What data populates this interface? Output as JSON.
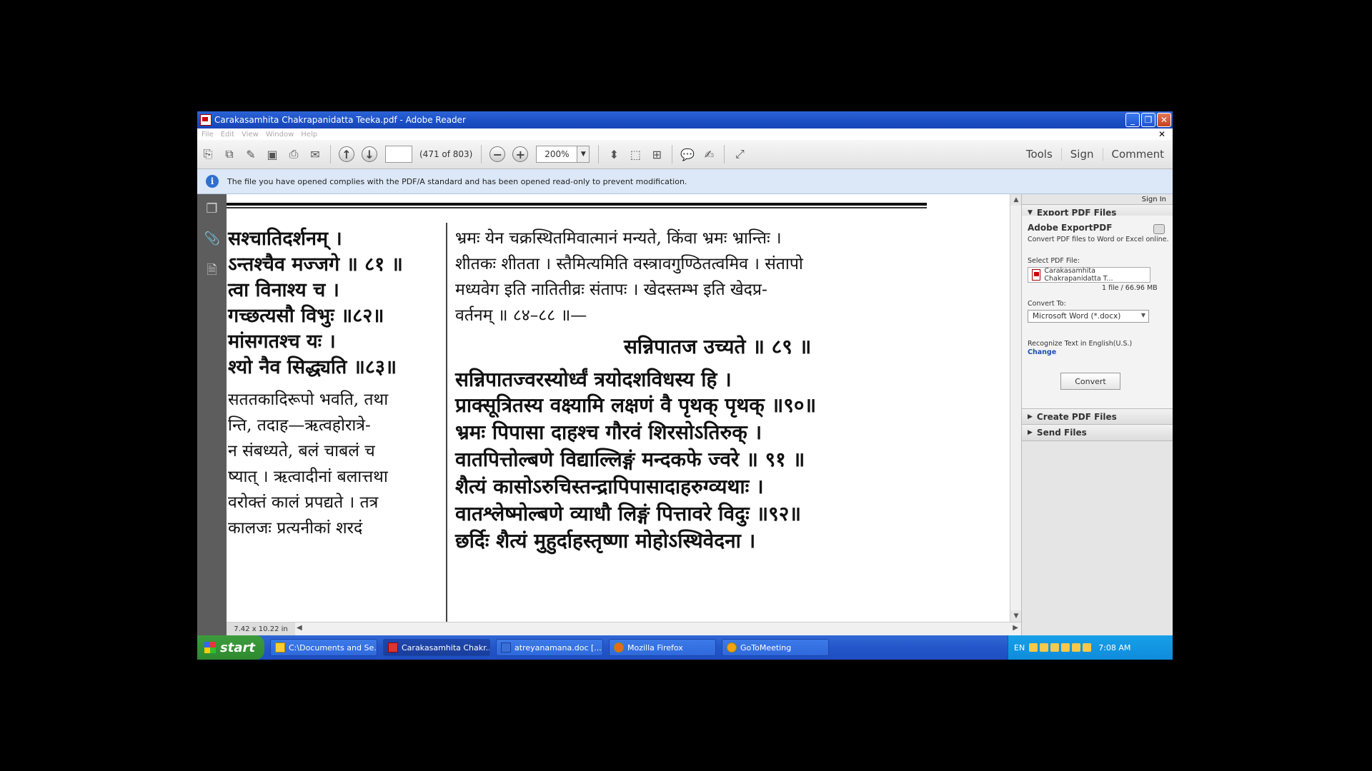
{
  "window": {
    "title": "Carakasamhita Chakrapanidatta Teeka.pdf - Adobe Reader"
  },
  "menu": [
    "File",
    "Edit",
    "View",
    "Window",
    "Help"
  ],
  "toolbar": {
    "page_count": "(471 of 803)",
    "zoom": "200%",
    "tools_label": "Tools",
    "sign_label": "Sign",
    "comment_label": "Comment"
  },
  "info_bar": {
    "message": "The file you have opened complies with the PDF/A standard and has been opened read-only to prevent modification."
  },
  "document": {
    "left_column": [
      "सश्चातिदर्शनम् ।",
      "ऽन्तश्चैव मज्जगे ॥ ८१ ॥",
      "त्वा विनाश्य च ।",
      "गच्छत्यसौ विभुः ॥८२॥",
      "मांसगतश्च यः ।",
      "श्यो नैव सिद्ध्यति ॥८३॥",
      "सततकादिरूपो भवति, तथा",
      "न्ति, तदाह—ऋत्वहोरात्रे-",
      "न संबध्यते, बलं चाबलं च",
      "ष्यात् । ऋत्वादीनां बलात्तथा",
      "वरोक्तं कालं प्रपद्यते । तत्र",
      "कालजः प्रत्यनीकां शरदं"
    ],
    "right_column": [
      "भ्रमः येन चक्रस्थितमिवात्मानं मन्यते, किंवा भ्रमः भ्रान्तिः ।",
      "शीतकः शीतता । स्तैमित्यमिति वस्त्रावगुण्ठितत्वमिव । संतापो",
      "मध्यवेग इति नातितीव्रः संतापः । खेदस्तम्भ इति खेदप्र-",
      "वर्तनम् ॥ ८४–८८ ॥—",
      "सन्निपातज उच्यते ॥ ८९ ॥",
      "सन्निपातज्वरस्योर्ध्वं त्रयोदशविधस्य हि ।",
      "प्राक्सूत्रितस्य वक्ष्यामि लक्षणं वै पृथक् पृथक् ॥९०॥",
      "भ्रमः पिपासा दाहश्च गौरवं शिरसोऽतिरुक् ।",
      "वातपित्तोल्बणे विद्याल्लिङ्गं मन्दकफे ज्वरे ॥ ९१ ॥",
      "शैत्यं कासोऽरुचिस्तन्द्रापिपासादाहरुग्व्यथाः ।",
      "वातश्लेष्मोल्बणे व्याधौ लिङ्गं पित्तावरे विदुः ॥९२॥",
      "छर्दिः शैत्यं मुहुर्दाहस्तृष्णा मोहोऽस्थिवेदना ।"
    ],
    "page_size": "7.42 x 10.22 in"
  },
  "right_pane": {
    "sign_in": "Sign In",
    "export_section": "Export PDF Files",
    "export_title": "Adobe ExportPDF",
    "export_desc": "Convert PDF files to Word or Excel online.",
    "select_label": "Select PDF File:",
    "file_name": "Carakasamhita Chakrapanidatta T...",
    "file_info": "1 file / 66.96 MB",
    "convert_to_label": "Convert To:",
    "convert_to_value": "Microsoft Word (*.docx)",
    "recognize_text": "Recognize Text in English(U.S.)",
    "change_link": "Change",
    "convert_button": "Convert",
    "create_section": "Create PDF Files",
    "send_section": "Send Files"
  },
  "taskbar": {
    "start": "start",
    "tasks": [
      "C:\\Documents and Se...",
      "Carakasamhita Chakr...",
      "atreyanamana.doc [...",
      "Mozilla Firefox",
      "GoToMeeting"
    ],
    "lang": "EN",
    "time": "7:08 AM"
  },
  "colors": {
    "titlebar": "#1A4FC4",
    "taskbar": "#2456C9",
    "tray": "#0F8CDC",
    "infobar": "#DCE8F7"
  }
}
